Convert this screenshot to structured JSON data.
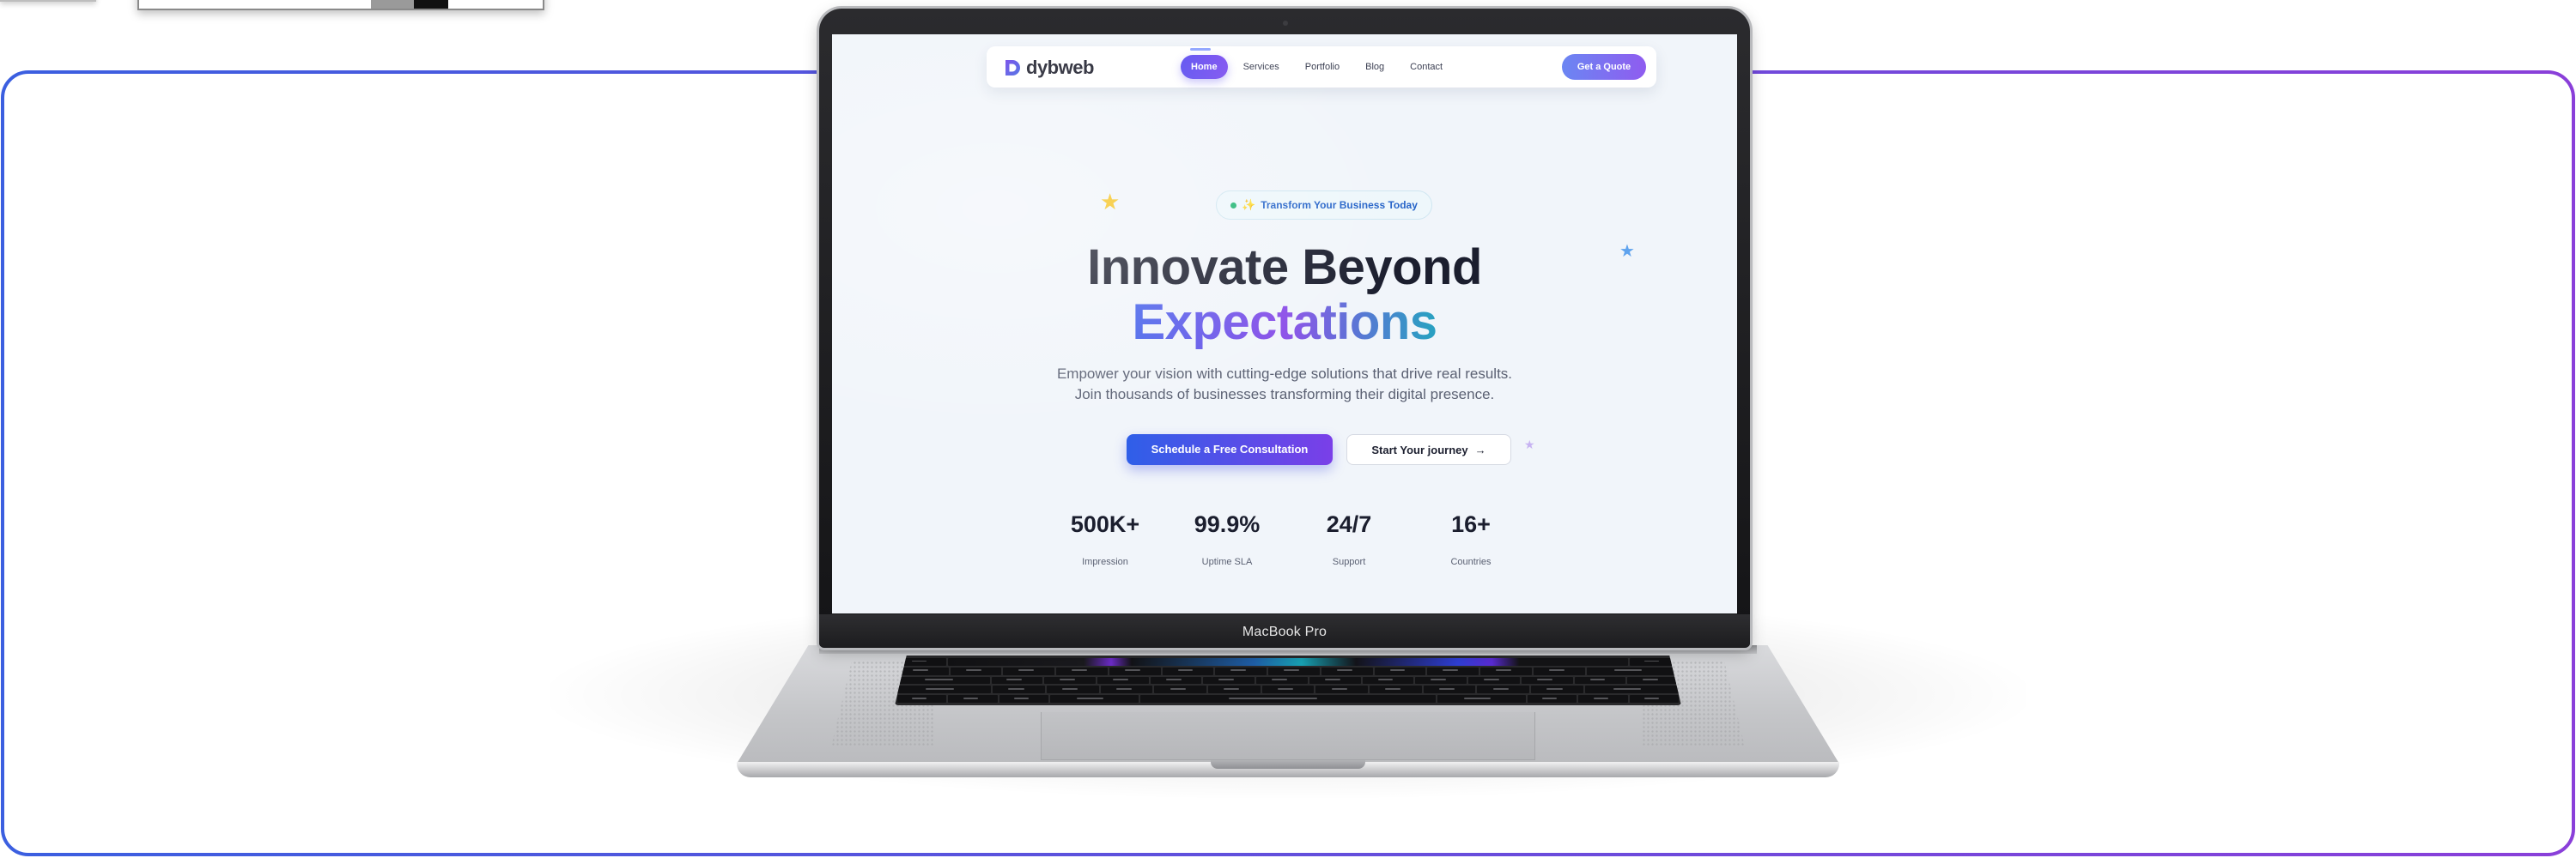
{
  "colors": {
    "frame_gradient_start": "#3b5fe0",
    "frame_gradient_end": "#8a3fd9",
    "brand_primary": "#5b4df0",
    "brand_accent": "#8b4ce8",
    "headline_dark": "#1b1e2e",
    "badge_text": "#2563c8"
  },
  "device": {
    "model_label": "MacBook Pro"
  },
  "site": {
    "brand": {
      "name": "dybweb",
      "logo_icon": "d-logo-icon"
    },
    "nav": {
      "links": [
        "Home",
        "Services",
        "Portfolio",
        "Blog",
        "Contact"
      ],
      "active": "Home",
      "cta": "Get a Quote"
    },
    "badge": {
      "sparkle_icon": "✨",
      "text": "Transform Your Business Today"
    },
    "hero": {
      "title_line1": "Innovate Beyond",
      "title_line2": "Expectations",
      "subtitle": "Empower your vision with cutting-edge solutions that drive real results. Join thousands of businesses transforming their digital presence."
    },
    "buttons": {
      "primary": "Schedule a Free Consultation",
      "secondary": "Start Your journey",
      "secondary_icon": "→"
    },
    "stats": [
      {
        "value": "500K+",
        "label": "Impression"
      },
      {
        "value": "99.9%",
        "label": "Uptime SLA"
      },
      {
        "value": "24/7",
        "label": "Support"
      },
      {
        "value": "16+",
        "label": "Countries"
      }
    ],
    "decorations": {
      "star_icon": "★"
    }
  }
}
